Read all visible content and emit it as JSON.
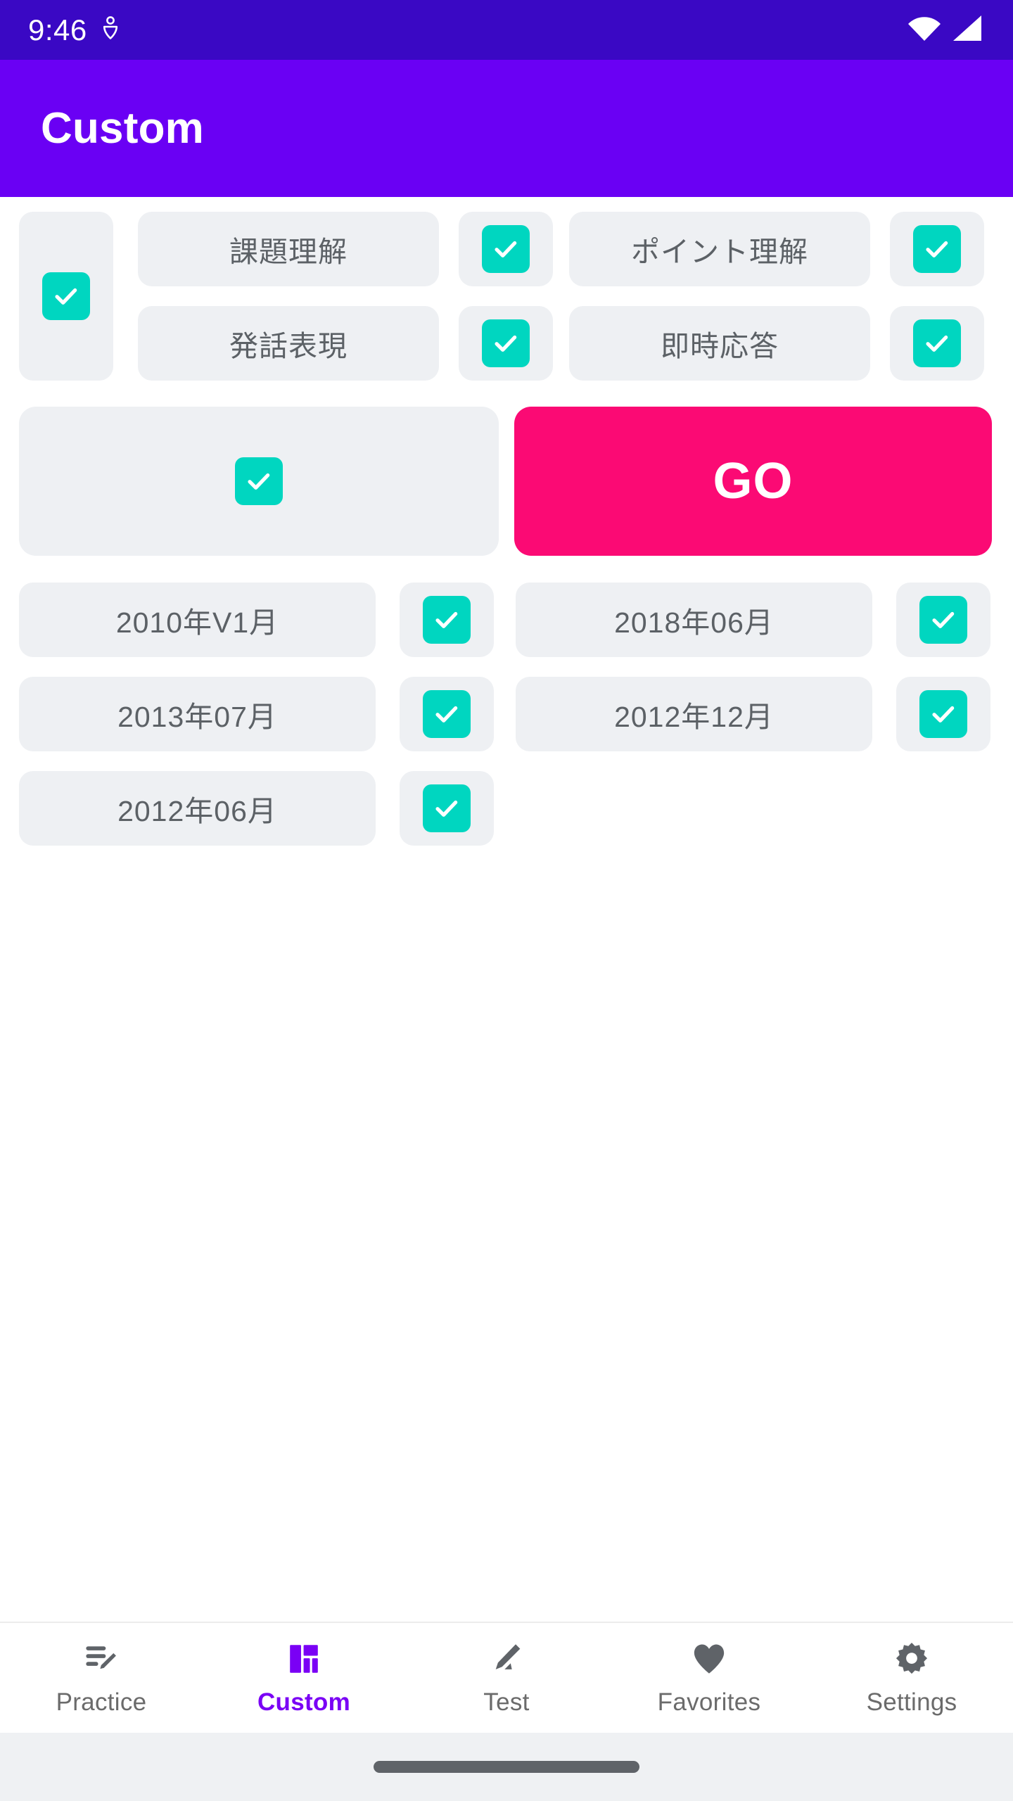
{
  "status_bar": {
    "time": "9:46",
    "icons": [
      "location-pin-icon",
      "wifi-icon",
      "cellular-signal-icon"
    ],
    "background_color": "#3A08C4"
  },
  "app_bar": {
    "title": "Custom",
    "background_color": "#6A00F4",
    "text_color": "#FFFFFF"
  },
  "theme": {
    "checkbox_color": "#00D6C0",
    "tile_color": "#EEF0F3",
    "accent_pink": "#FB0A74",
    "accent_purple": "#7A00F5",
    "label_color": "#5C6166"
  },
  "skills_section": {
    "master_checkbox": {
      "name": "select-all",
      "checked": true
    },
    "items": [
      {
        "label": "課題理解",
        "checked": true
      },
      {
        "label": "ポイント理解",
        "checked": true
      },
      {
        "label": "発話表現",
        "checked": true
      },
      {
        "label": "即時応答",
        "checked": true
      }
    ]
  },
  "action_row": {
    "checkbox": {
      "checked": true
    },
    "go_label": "GO"
  },
  "dates_section": {
    "items": [
      {
        "label": "2010年V1月",
        "checked": true
      },
      {
        "label": "2018年06月",
        "checked": true
      },
      {
        "label": "2013年07月",
        "checked": true
      },
      {
        "label": "2012年12月",
        "checked": true
      },
      {
        "label": "2012年06月",
        "checked": true
      }
    ]
  },
  "bottom_nav": {
    "active_index": 1,
    "items": [
      {
        "label": "Practice",
        "icon": "edit-note-icon"
      },
      {
        "label": "Custom",
        "icon": "dashboard-icon"
      },
      {
        "label": "Test",
        "icon": "draw-pencil-icon"
      },
      {
        "label": "Favorites",
        "icon": "heart-icon"
      },
      {
        "label": "Settings",
        "icon": "gear-icon"
      }
    ]
  }
}
